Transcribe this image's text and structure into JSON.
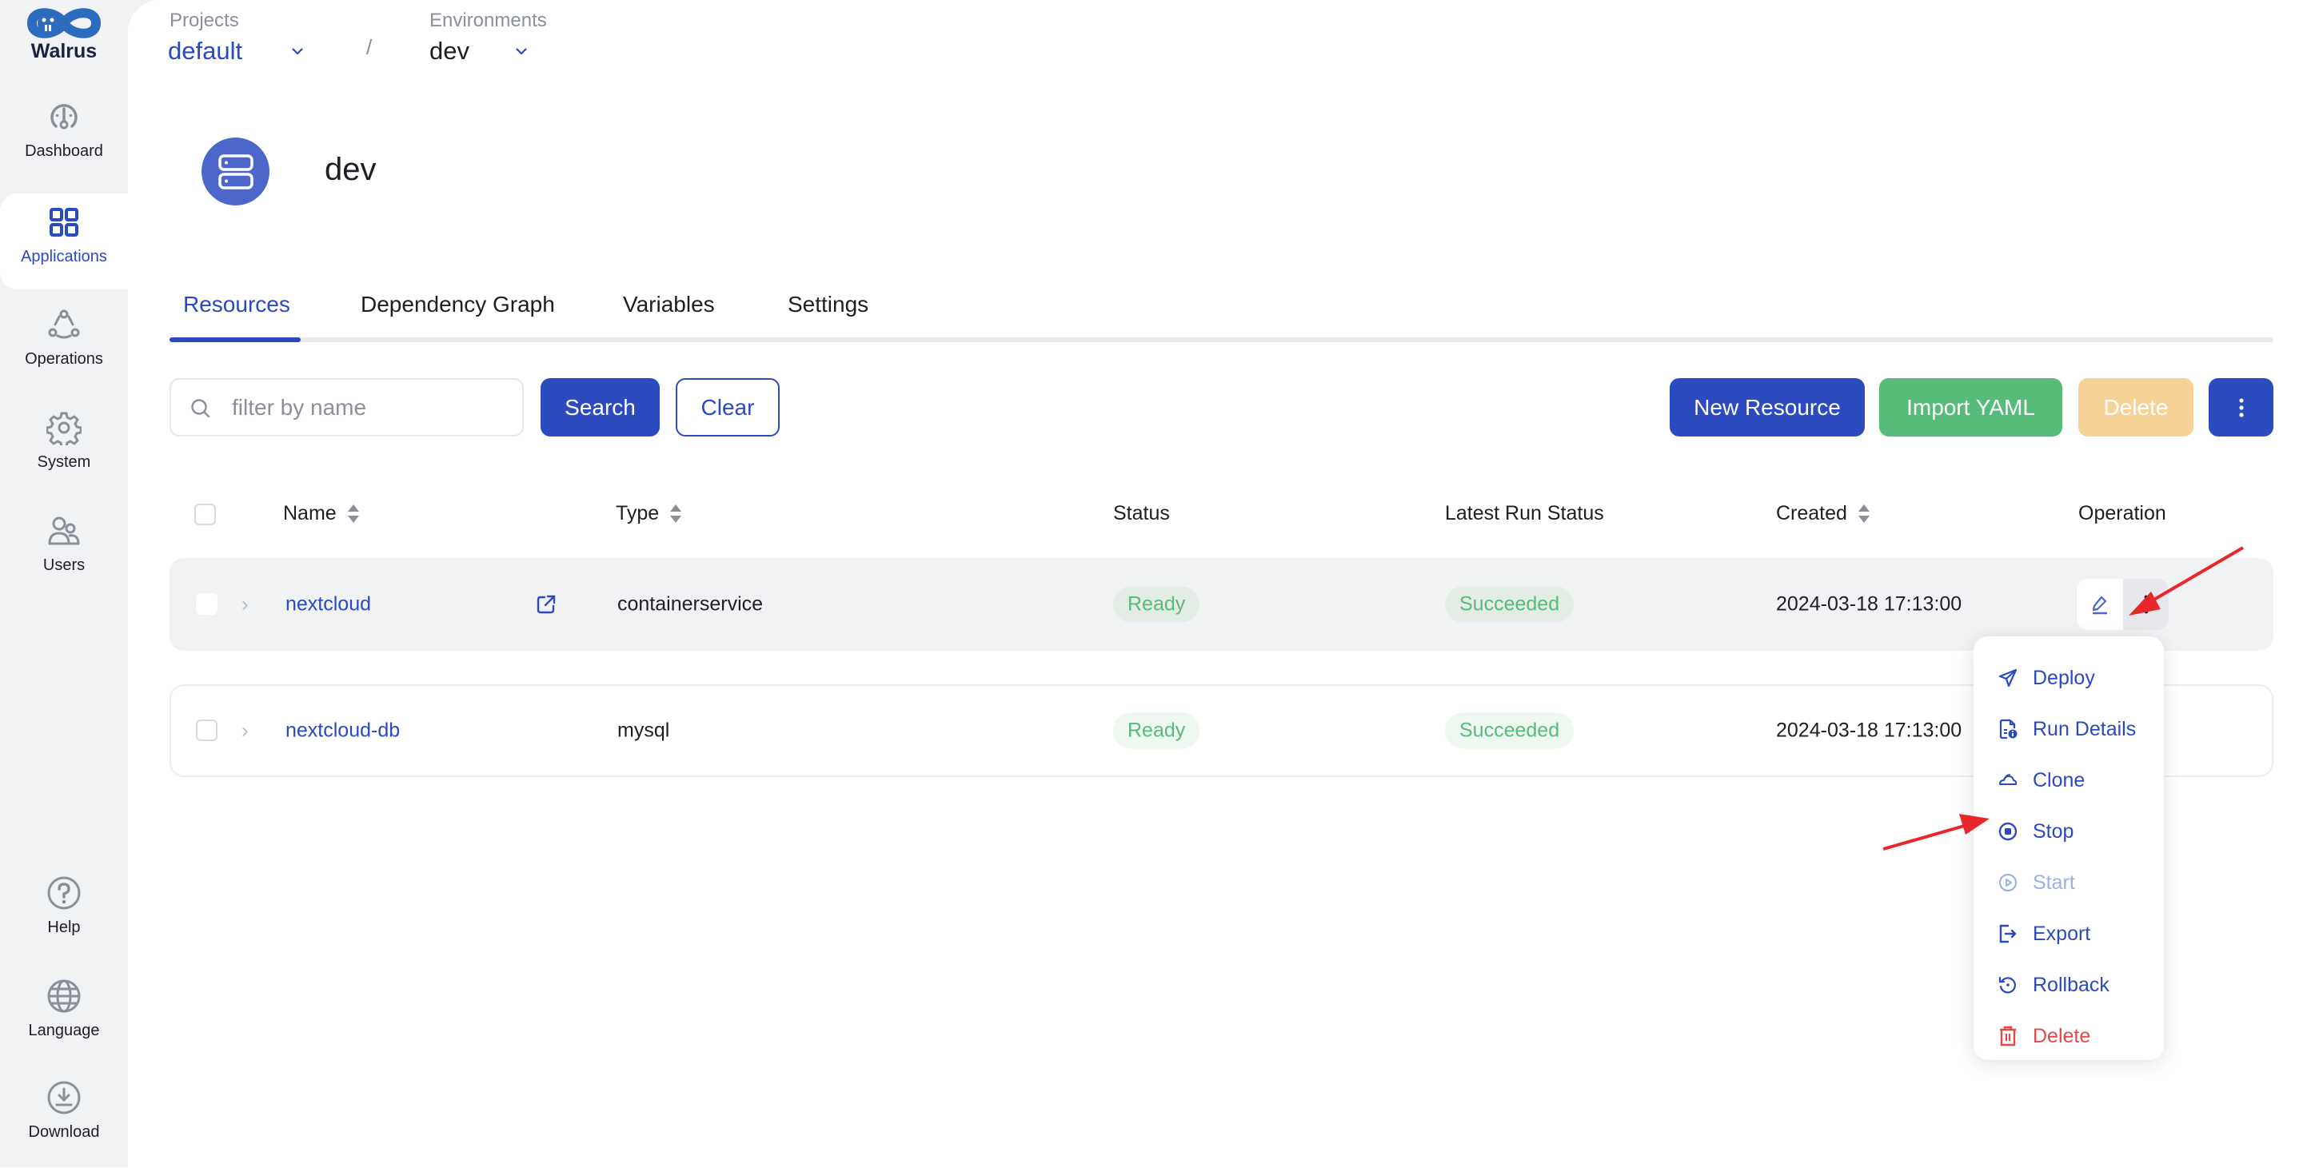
{
  "app": {
    "name": "Walrus",
    "accent_color": "#2b49c0"
  },
  "sidebar": {
    "items": [
      {
        "label": "Dashboard",
        "icon": "dashboard-gauge-icon",
        "active": false
      },
      {
        "label": "Applications",
        "icon": "applications-grid-icon",
        "active": true
      },
      {
        "label": "Operations",
        "icon": "operations-nodes-icon",
        "active": false
      },
      {
        "label": "System",
        "icon": "gear-icon",
        "active": false
      },
      {
        "label": "Users",
        "icon": "users-icon",
        "active": false
      }
    ],
    "bottom_items": [
      {
        "label": "Help",
        "icon": "help-circle-icon"
      },
      {
        "label": "Language",
        "icon": "globe-icon"
      },
      {
        "label": "Download",
        "icon": "download-circle-icon"
      }
    ]
  },
  "breadcrumb": {
    "project_label": "Projects",
    "project_value": "default",
    "separator": "/",
    "environment_label": "Environments",
    "environment_value": "dev"
  },
  "header": {
    "title": "dev",
    "icon": "server-icon"
  },
  "tabs": [
    {
      "label": "Resources",
      "active": true
    },
    {
      "label": "Dependency Graph",
      "active": false
    },
    {
      "label": "Variables",
      "active": false
    },
    {
      "label": "Settings",
      "active": false
    }
  ],
  "toolbar": {
    "search_placeholder": "filter by name",
    "search_value": "",
    "search_label": "Search",
    "clear_label": "Clear",
    "new_resource_label": "New Resource",
    "import_yaml_label": "Import YAML",
    "delete_label": "Delete",
    "more_icon": "more-vertical-icon"
  },
  "table": {
    "columns": [
      "Name",
      "Type",
      "Status",
      "Latest Run Status",
      "Created",
      "Operation"
    ],
    "sortable": {
      "Name": true,
      "Type": true,
      "Created": true
    },
    "rows": [
      {
        "name": "nextcloud",
        "has_external_link": true,
        "type": "containerservice",
        "status": "Ready",
        "latest_run_status": "Succeeded",
        "created": "2024-03-18 17:13:00"
      },
      {
        "name": "nextcloud-db",
        "has_external_link": false,
        "type": "mysql",
        "status": "Ready",
        "latest_run_status": "Succeeded",
        "created": "2024-03-18 17:13:00"
      }
    ]
  },
  "operation_menu": {
    "items": [
      {
        "label": "Deploy",
        "icon": "send-icon",
        "state": "enabled"
      },
      {
        "label": "Run Details",
        "icon": "file-info-icon",
        "state": "enabled"
      },
      {
        "label": "Clone",
        "icon": "cloud-icon",
        "state": "enabled"
      },
      {
        "label": "Stop",
        "icon": "stop-circle-icon",
        "state": "enabled"
      },
      {
        "label": "Start",
        "icon": "play-circle-icon",
        "state": "disabled"
      },
      {
        "label": "Export",
        "icon": "export-icon",
        "state": "enabled"
      },
      {
        "label": "Rollback",
        "icon": "rollback-icon",
        "state": "enabled"
      },
      {
        "label": "Delete",
        "icon": "trash-icon",
        "state": "danger"
      }
    ]
  },
  "annotations": {
    "arrow_color": "#e8262b"
  }
}
